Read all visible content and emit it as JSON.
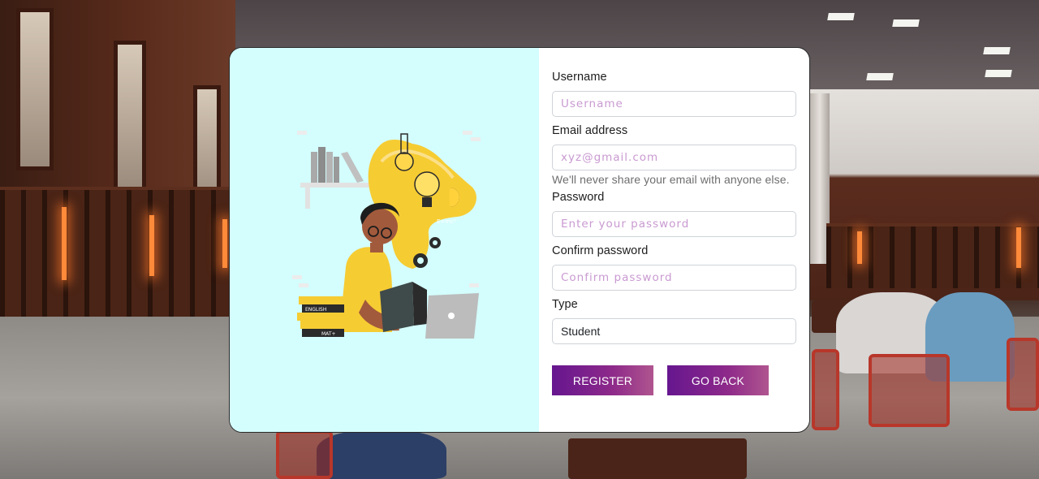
{
  "form": {
    "username": {
      "label": "Username",
      "placeholder": "Username"
    },
    "email": {
      "label": "Email address",
      "placeholder": "xyz@gmail.com",
      "hint": "We'll never share your email with anyone else."
    },
    "password": {
      "label": "Password",
      "placeholder": "Enter your password"
    },
    "confirm_password": {
      "label": "Confirm password",
      "placeholder": "Confirm password"
    },
    "type": {
      "label": "Type",
      "selected": "Student"
    },
    "register_label": "REGISTER",
    "go_back_label": "GO BACK"
  },
  "illustration": {
    "book_labels": [
      "ENGLISH",
      "MAT+"
    ],
    "icon": "student-reading-illustration"
  },
  "colors": {
    "panel_bg": "#d4fdfd",
    "button_start": "#66168f",
    "button_end": "#b0558f",
    "placeholder": "#c99ad1",
    "accent_yellow": "#f6cc33"
  }
}
